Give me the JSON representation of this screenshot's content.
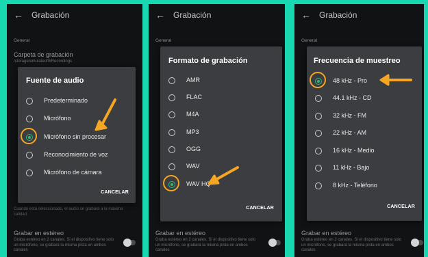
{
  "colors": {
    "background": "#17d8b0",
    "accent": "#f5a623",
    "radio_selected": "#2cbc7a",
    "dialog": "#3c3d40"
  },
  "panels": [
    {
      "title": "Grabación",
      "section": "General",
      "bg_setting_title": "Carpeta de grabación",
      "bg_setting_sub": "/storage/emulated/0/Recordings",
      "bg_faint_text": "Cuando está seleccionado, el audio se grabará a la máxima calidad.",
      "stereo_title": "Grabar en estéreo",
      "stereo_desc": "Graba estéreo en 2 canales. Si el dispositivo tiene solo un micrófono, se grabará la misma pista en ambos canales",
      "dialog": {
        "title": "Fuente de audio",
        "options": [
          "Predeterminado",
          "Micrófono",
          "Micrófono sin procesar",
          "Reconocimiento de voz",
          "Micrófono de cámara"
        ],
        "selected": "Micrófono sin procesar",
        "cancel": "CANCELAR"
      }
    },
    {
      "title": "Grabación",
      "section": "General",
      "stereo_title": "Grabar en estéreo",
      "stereo_desc": "Graba estéreo en 2 canales. Si el dispositivo tiene solo un micrófono, se grabará la misma pista en ambos canales",
      "dialog": {
        "title": "Formato de grabación",
        "options": [
          "AMR",
          "FLAC",
          "M4A",
          "MP3",
          "OGG",
          "WAV",
          "WAV HQ"
        ],
        "selected": "WAV HQ",
        "cancel": "CANCELAR"
      }
    },
    {
      "title": "Grabación",
      "section": "General",
      "stereo_title": "Grabar en estéreo",
      "stereo_desc": "Graba estéreo en 2 canales. Si el dispositivo tiene solo un micrófono, se grabará la misma pista en ambos canales",
      "dialog": {
        "title": "Frecuencia de muestreo",
        "options": [
          "48 kHz - Pro",
          "44.1 kHz - CD",
          "32 kHz - FM",
          "22 kHz - AM",
          "16 kHz - Medio",
          "11 kHz - Bajo",
          "8 kHz - Teléfono"
        ],
        "selected": "48 kHz - Pro",
        "cancel": "CANCELAR"
      }
    }
  ]
}
